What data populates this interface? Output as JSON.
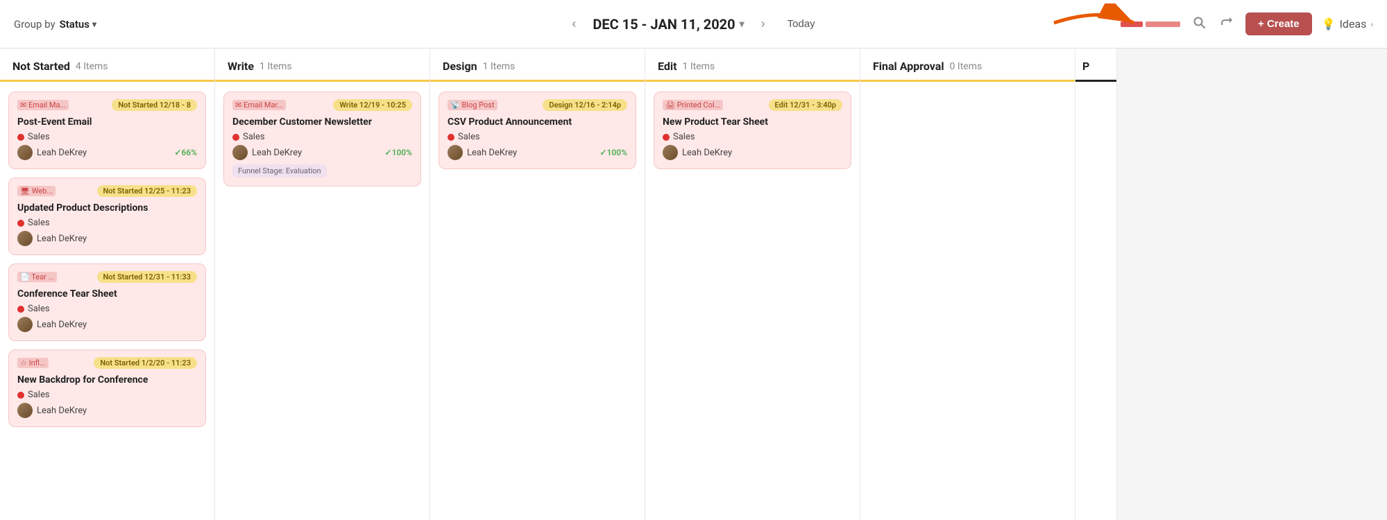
{
  "header": {
    "group_by_label": "Group by",
    "group_by_value": "Status",
    "date_range": "DEC 15 - JAN 11, 2020",
    "today_label": "Today",
    "create_label": "+ Create",
    "ideas_label": "Ideas"
  },
  "columns": [
    {
      "id": "not-started",
      "title": "Not Started",
      "count": "4 Items",
      "cards": [
        {
          "type_icon": "✉",
          "type_label": "Email Ma...",
          "status": "Not Started 12/18 - 8",
          "title": "Post-Event Email",
          "tag": "Sales",
          "assignee": "Leah DeKrey",
          "progress": "✓66%",
          "extra": null
        },
        {
          "type_icon": "🖥",
          "type_label": "Web...",
          "status": "Not Started 12/25 - 11:23",
          "title": "Updated Product Descriptions",
          "tag": "Sales",
          "assignee": "Leah DeKrey",
          "progress": null,
          "extra": null
        },
        {
          "type_icon": "📄",
          "type_label": "Tear ...",
          "status": "Not Started 12/31 - 11:33",
          "title": "Conference Tear Sheet",
          "tag": "Sales",
          "assignee": "Leah DeKrey",
          "progress": null,
          "extra": null
        },
        {
          "type_icon": "☆",
          "type_label": "Infl...",
          "status": "Not Started 1/2/20 - 11:23",
          "title": "New Backdrop for Conference",
          "tag": "Sales",
          "assignee": "Leah DeKrey",
          "progress": null,
          "extra": null
        }
      ]
    },
    {
      "id": "write",
      "title": "Write",
      "count": "1 Items",
      "cards": [
        {
          "type_icon": "✉",
          "type_label": "Email Mar...",
          "status": "Write 12/19 - 10:25",
          "title": "December Customer Newsletter",
          "tag": "Sales",
          "assignee": "Leah DeKrey",
          "progress": "✓100%",
          "extra": "Funnel Stage: Evaluation"
        }
      ]
    },
    {
      "id": "design",
      "title": "Design",
      "count": "1 Items",
      "cards": [
        {
          "type_icon": "📡",
          "type_label": "Blog Post",
          "status": "Design 12/16 - 2:14p",
          "title": "CSV Product Announcement",
          "tag": "Sales",
          "assignee": "Leah DeKrey",
          "progress": "✓100%",
          "extra": null
        }
      ]
    },
    {
      "id": "edit",
      "title": "Edit",
      "count": "1 Items",
      "cards": [
        {
          "type_icon": "🖨",
          "type_label": "Printed Col...",
          "status": "Edit 12/31 - 3:40p",
          "title": "New Product Tear Sheet",
          "tag": "Sales",
          "assignee": "Leah DeKrey",
          "progress": null,
          "extra": null
        }
      ]
    },
    {
      "id": "final-approval",
      "title": "Final Approval",
      "count": "0 Items",
      "cards": []
    },
    {
      "id": "partial",
      "title": "P",
      "count": "",
      "cards": []
    }
  ]
}
